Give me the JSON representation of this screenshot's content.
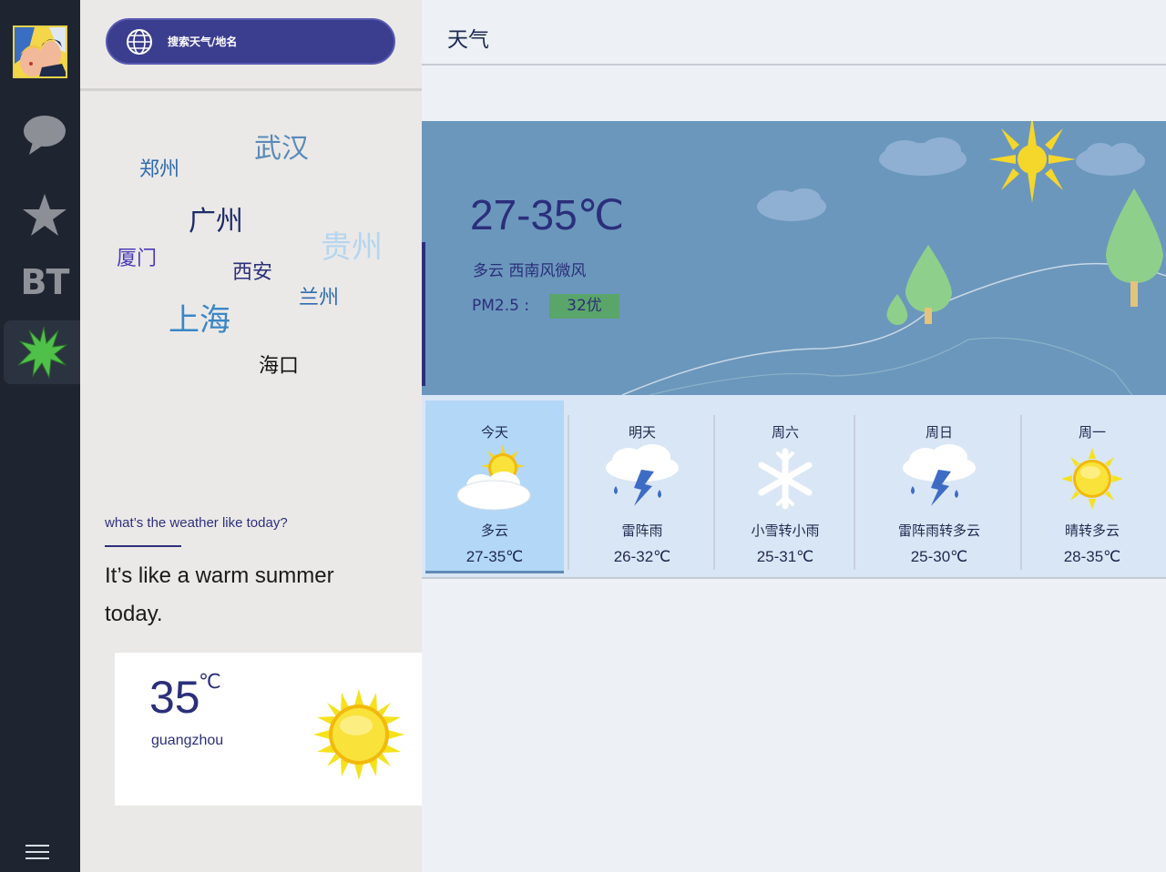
{
  "nav": {
    "items": [
      "avatar",
      "chat-bubble-icon",
      "star-icon",
      "bt-icon",
      "burst-icon"
    ],
    "bt_label": "BT",
    "menu_icon": "hamburger-icon"
  },
  "search": {
    "placeholder": "搜索天气/地名",
    "icon": "globe-icon"
  },
  "cities": [
    {
      "name": "武汉",
      "color": "#5b8ab8"
    },
    {
      "name": "郑州",
      "color": "#2e6bb0"
    },
    {
      "name": "广州",
      "color": "#1d2a6b"
    },
    {
      "name": "贵州",
      "color": "#b4d6ef"
    },
    {
      "name": "厦门",
      "color": "#4a3ab8"
    },
    {
      "name": "西安",
      "color": "#2b2f7a"
    },
    {
      "name": "兰州",
      "color": "#2e6bb0"
    },
    {
      "name": "上海",
      "color": "#3a86c7"
    },
    {
      "name": "海口",
      "color": "#111111"
    }
  ],
  "question": {
    "label": "what’s the weather like today?",
    "answer": "It’s like a warm summer today."
  },
  "current_card": {
    "temp": "35",
    "unit": "℃",
    "city": "guangzhou",
    "icon": "sun-icon"
  },
  "header": {
    "title": "天气"
  },
  "today": {
    "range": "27-35℃",
    "description": "多云  西南风微风",
    "pm_label": "PM2.5 :",
    "pm_value": "32优",
    "colors": {
      "hero_bg": "#6b97bd",
      "pm_badge": "#5aa56a"
    }
  },
  "forecast": [
    {
      "day": "今天",
      "condition": "多云",
      "range": "27-35℃",
      "icon": "partly-cloudy-icon",
      "selected": true
    },
    {
      "day": "明天",
      "condition": "雷阵雨",
      "range": "26-32℃",
      "icon": "thunderstorm-icon",
      "selected": false
    },
    {
      "day": "周六",
      "condition": "小雪转小雨",
      "range": "25-31℃",
      "icon": "snowflake-icon",
      "selected": false
    },
    {
      "day": "周日",
      "condition": "雷阵雨转多云",
      "range": "25-30℃",
      "icon": "thunderstorm-icon",
      "selected": false
    },
    {
      "day": "周一",
      "condition": "晴转多云",
      "range": "28-35℃",
      "icon": "sun-icon",
      "selected": false
    }
  ]
}
